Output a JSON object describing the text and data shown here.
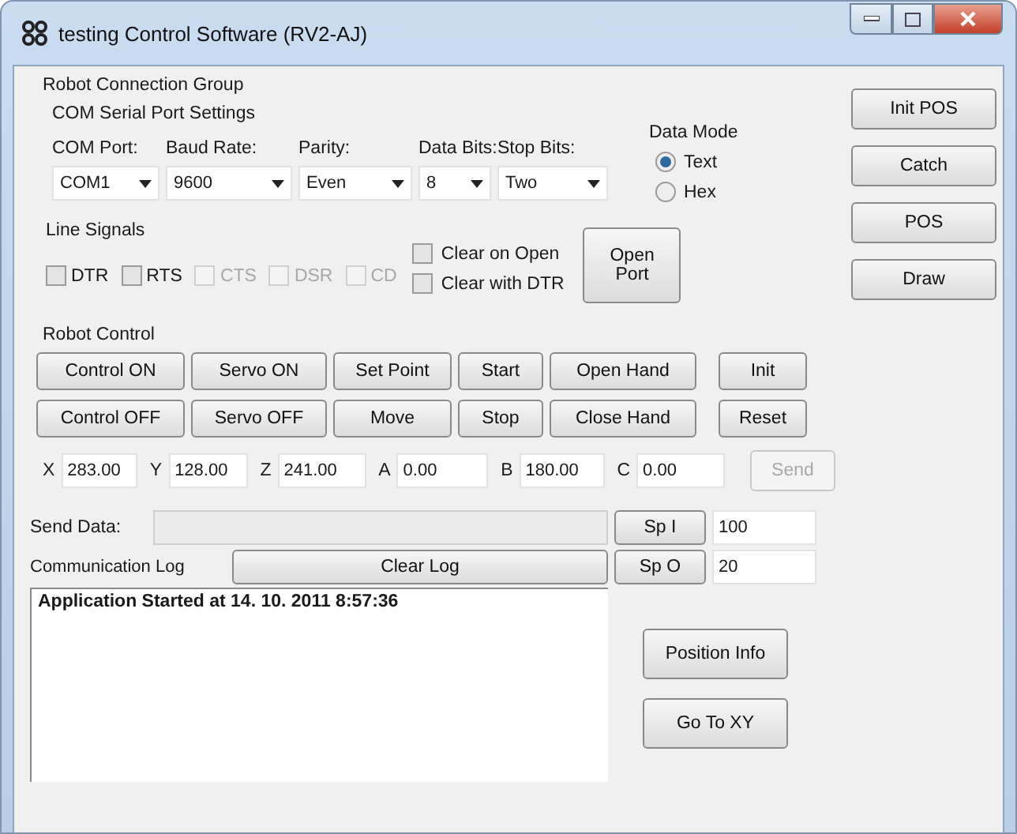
{
  "window": {
    "title": "testing Control Software  (RV2-AJ)"
  },
  "connection_group": {
    "title": "Robot Connection Group",
    "serial": {
      "title": "COM Serial Port Settings",
      "fields": [
        {
          "label": "COM Port:",
          "value": "COM1"
        },
        {
          "label": "Baud Rate:",
          "value": "9600"
        },
        {
          "label": "Parity:",
          "value": "Even"
        },
        {
          "label": "Data Bits:",
          "value": "8"
        },
        {
          "label": "Stop Bits:",
          "value": "Two"
        }
      ]
    },
    "data_mode": {
      "title": "Data Mode",
      "options": [
        {
          "label": "Text",
          "selected": true
        },
        {
          "label": "Hex",
          "selected": false
        }
      ]
    },
    "line_signals": {
      "title": "Line Signals",
      "signals": [
        {
          "label": "DTR",
          "checked": false,
          "disabled": false
        },
        {
          "label": "RTS",
          "checked": false,
          "disabled": false
        },
        {
          "label": "CTS",
          "checked": false,
          "disabled": true
        },
        {
          "label": "DSR",
          "checked": false,
          "disabled": true
        },
        {
          "label": "CD",
          "checked": false,
          "disabled": true
        }
      ],
      "clear_options": [
        {
          "label": "Clear on Open",
          "checked": false
        },
        {
          "label": "Clear with DTR",
          "checked": false
        }
      ]
    },
    "open_port_button": "Open Port"
  },
  "robot_control": {
    "title": "Robot Control",
    "button_rows": [
      {
        "buttons": [
          "Control ON",
          "Servo ON",
          "Set Point",
          "Start",
          "Open Hand"
        ],
        "side_button": {
          "label": "Init",
          "disabled": false
        }
      },
      {
        "buttons": [
          "Control OFF",
          "Servo OFF",
          "Move",
          "Stop",
          "Close Hand"
        ],
        "side_button": {
          "label": "Reset",
          "disabled": false
        }
      }
    ],
    "coordinates": [
      {
        "label": "X",
        "value": "283.00"
      },
      {
        "label": "Y",
        "value": "128.00"
      },
      {
        "label": "Z",
        "value": "241.00"
      },
      {
        "label": "A",
        "value": "0.00"
      },
      {
        "label": "B",
        "value": "180.00"
      },
      {
        "label": "C",
        "value": "0.00"
      }
    ],
    "send_button": {
      "label": "Send",
      "disabled": true
    }
  },
  "send_data": {
    "label": "Send Data:",
    "speed_button": "Sp I",
    "speed_value": "100"
  },
  "communication_log": {
    "label": "Communication Log",
    "clear_button": "Clear Log",
    "speed_button": "Sp O",
    "speed_value": "20",
    "lines": [
      "Application Started at 14. 10. 2011 8:57:36"
    ]
  },
  "side_buttons": [
    "Init POS",
    "Catch",
    "POS",
    "Draw"
  ],
  "bottom_buttons": [
    "Position Info",
    "Go To XY"
  ]
}
